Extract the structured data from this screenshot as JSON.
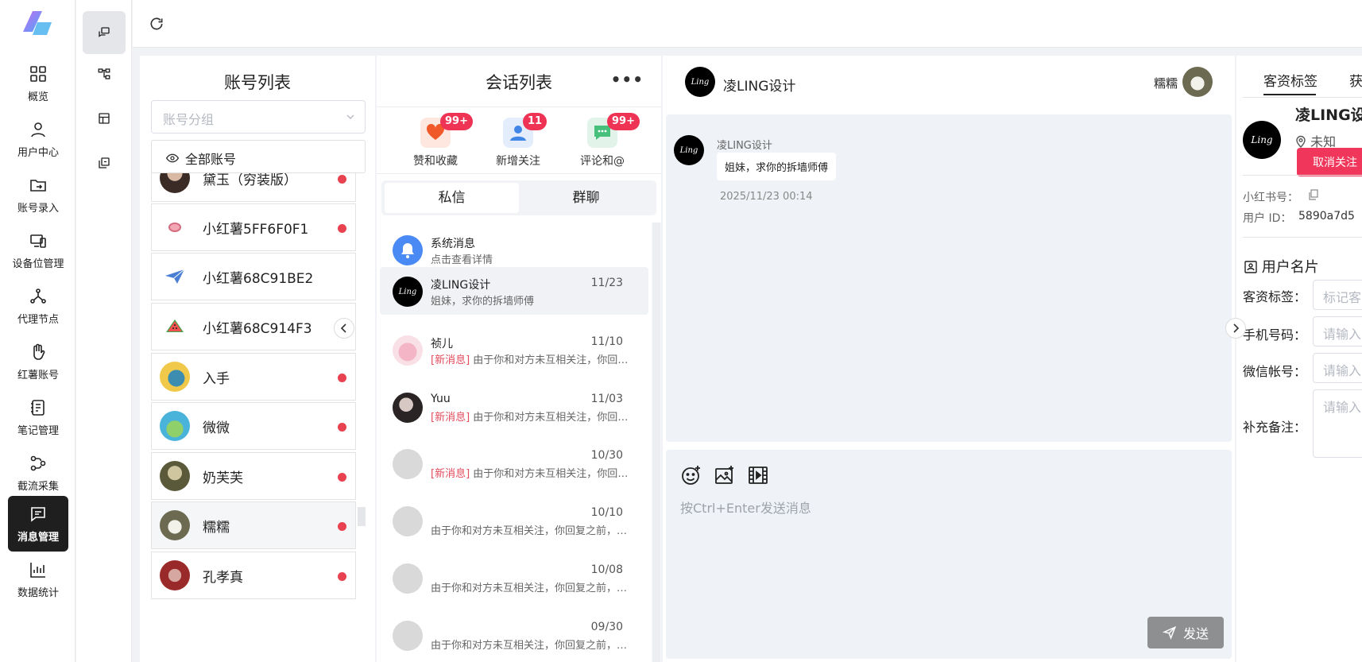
{
  "nav": {
    "items": [
      {
        "label": "概览",
        "icon": "grid-icon"
      },
      {
        "label": "用户中心",
        "icon": "user-icon"
      },
      {
        "label": "账号录入",
        "icon": "folder-sync-icon"
      },
      {
        "label": "设备位管理",
        "icon": "devices-icon"
      },
      {
        "label": "代理节点",
        "icon": "nodes-icon"
      },
      {
        "label": "红薯账号",
        "icon": "hand-icon"
      },
      {
        "label": "笔记管理",
        "icon": "notebook-icon"
      },
      {
        "label": "截流采集",
        "icon": "flow-icon"
      },
      {
        "label": "消息管理",
        "icon": "message-icon"
      },
      {
        "label": "数据统计",
        "icon": "chart-icon"
      }
    ],
    "active": "消息管理"
  },
  "accounts": {
    "title": "账号列表",
    "group_placeholder": "账号分组",
    "all_label": "全部账号",
    "items": [
      {
        "name": "黛玉（穷装版）",
        "unread": true
      },
      {
        "name": "小红薯5FF6F0F1",
        "unread": true
      },
      {
        "name": "小红薯68C91BE2",
        "unread": false
      },
      {
        "name": "小红薯68C914F3",
        "unread": false
      },
      {
        "name": "入手",
        "unread": true
      },
      {
        "name": "微微",
        "unread": true
      },
      {
        "name": "奶芙芙",
        "unread": true
      },
      {
        "name": "糯糯",
        "unread": true
      },
      {
        "name": "孔孝真",
        "unread": true
      }
    ]
  },
  "sessions": {
    "title": "会话列表",
    "more": "•••",
    "quick": [
      {
        "label": "赞和收藏",
        "badge": "99+",
        "color": "#fde7df"
      },
      {
        "label": "新增关注",
        "badge": "11",
        "color": "#e3edfb"
      },
      {
        "label": "评论和@",
        "badge": "99+",
        "color": "#e2f4ea"
      }
    ],
    "tabs": [
      "私信",
      "群聊"
    ],
    "new_tag": "[新消息]",
    "items": [
      {
        "name": "系统消息",
        "date": "",
        "msg": "点击查看详情",
        "new": false
      },
      {
        "name": "凌LING设计",
        "date": "11/23",
        "msg": "姐妹，求你的拆墙师傅",
        "new": false
      },
      {
        "name": "祯儿",
        "date": "11/10",
        "msg": "由于你和对方未互相关注，你回复之前，对方只能发一条消息",
        "new": true
      },
      {
        "name": "Yuu",
        "date": "11/03",
        "msg": "由于你和对方未互相关注，你回复之前，对方只能发一条消息",
        "new": true
      },
      {
        "name": "",
        "date": "10/30",
        "msg": "由于你和对方未互相关注，你回复之前，对方只能发一条消息",
        "new": true
      },
      {
        "name": "",
        "date": "10/10",
        "msg": "由于你和对方未互相关注，你回复之前，对方只能发一条消息",
        "new": false
      },
      {
        "name": "",
        "date": "10/08",
        "msg": "由于你和对方未互相关注，你回复之前，对方只能发一条消息",
        "new": false
      },
      {
        "name": "",
        "date": "09/30",
        "msg": "由于你和对方未互相关注，你回复之前，对方只能发一条消息",
        "new": false
      }
    ]
  },
  "chat": {
    "contact_name": "凌LING设计",
    "me_name": "糯糯",
    "messages": [
      {
        "sender": "凌LING设计",
        "text": "姐妹，求你的拆墙师傅",
        "time": "2025/11/23 00:14"
      }
    ],
    "input_placeholder": "按Ctrl+Enter发送消息",
    "send_label": "发送",
    "tools": [
      "emoji-icon",
      "image-icon",
      "video-icon"
    ]
  },
  "profile": {
    "tabs": [
      "客资标签",
      "获"
    ],
    "name": "凌LING设",
    "location": "未知",
    "unfollow_label": "取消关注",
    "xhs_label": "小红书号：",
    "uid_label": "用户 ID：",
    "uid_value": "5890a7d5",
    "card_title": "用户名片",
    "fields": [
      {
        "label": "客资标签：",
        "placeholder": "标记客"
      },
      {
        "label": "手机号码：",
        "placeholder": "请输入"
      },
      {
        "label": "微信帐号：",
        "placeholder": "请输入"
      },
      {
        "label": "补充备注：",
        "placeholder": "请输入"
      }
    ]
  },
  "colors": {
    "accent": "#ee3355",
    "active_nav": "#1f1f1f",
    "unread_dot": "#e8414f"
  }
}
